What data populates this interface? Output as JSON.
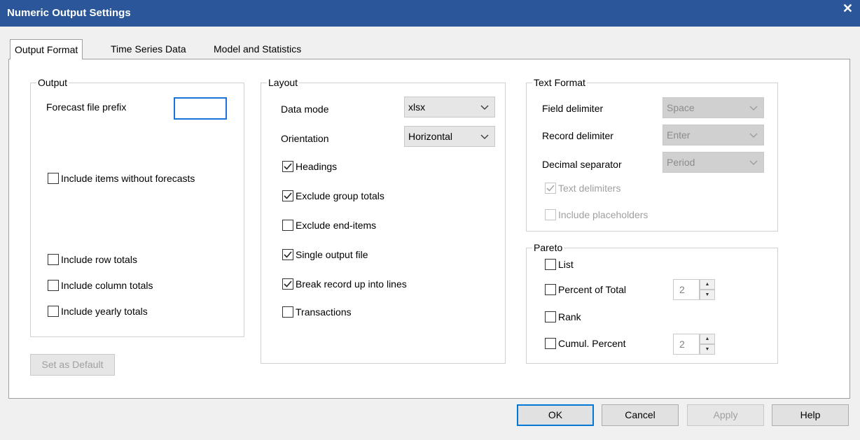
{
  "window": {
    "title": "Numeric Output Settings",
    "close_glyph": "✕"
  },
  "tabs": [
    {
      "label": "Output Format",
      "active": true
    },
    {
      "label": "Time Series Data",
      "active": false
    },
    {
      "label": "Model and Statistics",
      "active": false
    }
  ],
  "output": {
    "legend": "Output",
    "forecast_prefix_label": "Forecast file prefix",
    "forecast_prefix_value": "",
    "include_items_without_forecasts": {
      "label": "Include items without forecasts",
      "checked": false
    },
    "include_row_totals": {
      "label": "Include row totals",
      "checked": false
    },
    "include_column_totals": {
      "label": "Include column totals",
      "checked": false
    },
    "include_yearly_totals": {
      "label": "Include yearly totals",
      "checked": false
    }
  },
  "set_default_label": "Set as Default",
  "layout": {
    "legend": "Layout",
    "data_mode_label": "Data mode",
    "data_mode_value": "xlsx",
    "orientation_label": "Orientation",
    "orientation_value": "Horizontal",
    "headings": {
      "label": "Headings",
      "checked": true
    },
    "exclude_group_totals": {
      "label": "Exclude group totals",
      "checked": true
    },
    "exclude_end_items": {
      "label": "Exclude end-items",
      "checked": false
    },
    "single_output_file": {
      "label": "Single output file",
      "checked": true
    },
    "break_record": {
      "label": "Break record up into lines",
      "checked": true
    },
    "transactions": {
      "label": "Transactions",
      "checked": false
    }
  },
  "text_format": {
    "legend": "Text Format",
    "field_delimiter_label": "Field delimiter",
    "field_delimiter_value": "Space",
    "record_delimiter_label": "Record delimiter",
    "record_delimiter_value": "Enter",
    "decimal_separator_label": "Decimal separator",
    "decimal_separator_value": "Period",
    "text_delimiters": {
      "label": "Text delimiters",
      "checked": true
    },
    "include_placeholders": {
      "label": "Include placeholders",
      "checked": false
    }
  },
  "pareto": {
    "legend": "Pareto",
    "list": {
      "label": "List",
      "checked": false
    },
    "percent_of_total": {
      "label": "Percent of Total",
      "checked": false,
      "value": "2"
    },
    "rank": {
      "label": "Rank",
      "checked": false
    },
    "cumul_percent": {
      "label": "Cumul. Percent",
      "checked": false,
      "value": "2"
    }
  },
  "buttons": {
    "ok": "OK",
    "cancel": "Cancel",
    "apply": "Apply",
    "help": "Help"
  }
}
